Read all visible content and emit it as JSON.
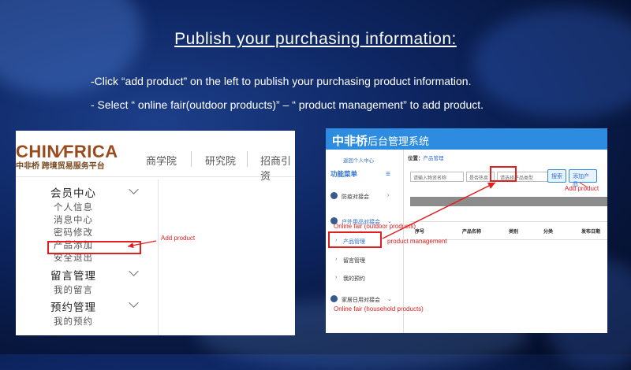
{
  "slide": {
    "title": "Publish your purchasing information:",
    "instruction_1": "-Click “add product” on the left to publish your purchasing product information.",
    "instruction_2": "- Select “ online fair(outdoor products)” – “ product management” to add product."
  },
  "left_screenshot": {
    "logo": "CHIN∕FRICA",
    "logo_sub": "中非桥 跨境贸易服务平台",
    "nav": [
      "商学院",
      "研究院",
      "招商引资"
    ],
    "menu": {
      "member_center": "会员中心",
      "member_items": [
        "个人信息",
        "消息中心",
        "密码修改",
        "产品添加",
        "安全退出"
      ],
      "message_mgmt": "留言管理",
      "message_items": [
        "我的留言"
      ],
      "booking_mgmt": "预约管理",
      "booking_items": [
        "我的预约"
      ]
    }
  },
  "right_screenshot": {
    "system_name_bold": "中非桥",
    "system_name": "后台管理系统",
    "back_link": "返回个人中心",
    "function_menu": "功能菜单",
    "hamburger": "≡",
    "sidebar_items": [
      "防疫对接会",
      "户外用品对接会",
      "产品管理",
      "留言管理",
      "我的预约",
      "家居日用对接会"
    ],
    "breadcrumb_prefix": "位置：",
    "breadcrumb_current": "产品管理",
    "search_placeholder": "请输入物资名称",
    "select_hot": "是否热卖",
    "select_type": "请选择产品类型",
    "search_button": "搜索",
    "add_button": "添加产品",
    "table_headers": [
      "序号",
      "产品名称",
      "类别",
      "分类",
      "发布日期"
    ]
  },
  "annotations": {
    "add_product_left": "Add product",
    "add_product_right": "Add product",
    "outdoor": "Online fair (outdoor products)",
    "product_mgmt": "product management",
    "household": "Online fair (household products)"
  },
  "colors": {
    "accent_red": "#e0201f",
    "header_blue": "#2e8ce0"
  }
}
